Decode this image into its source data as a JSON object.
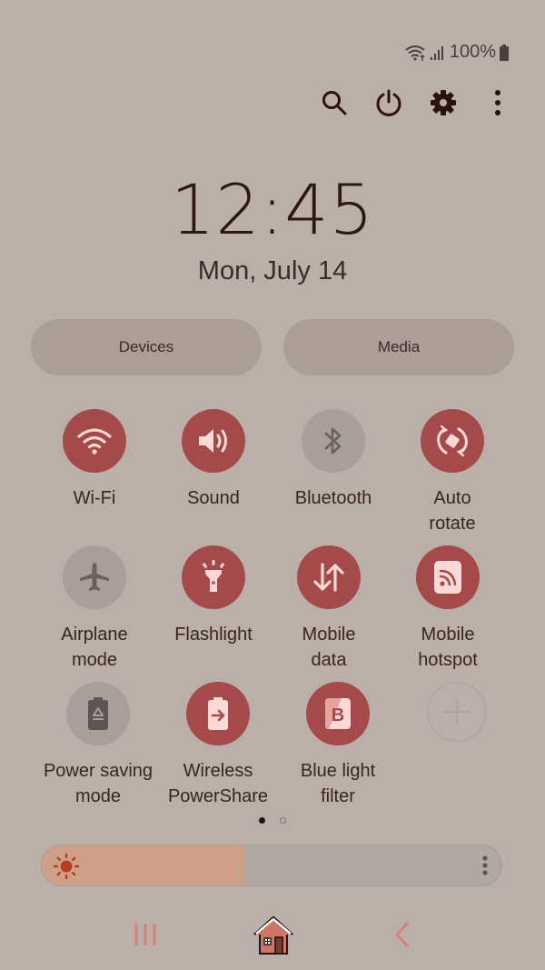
{
  "status_bar": {
    "wifi_icon": "wifi-icon",
    "signal_icon": "signal-icon",
    "battery_percent": "100%",
    "battery_icon": "battery-icon"
  },
  "top_actions": [
    {
      "name": "search",
      "icon": "search-icon"
    },
    {
      "name": "power",
      "icon": "power-icon"
    },
    {
      "name": "settings",
      "icon": "gear-icon"
    },
    {
      "name": "more",
      "icon": "more-vertical-icon"
    }
  ],
  "clock": {
    "time": "12:45",
    "date": "Mon, July 14"
  },
  "pills": {
    "devices": "Devices",
    "media": "Media"
  },
  "tiles": [
    {
      "label": "Wi-Fi",
      "icon": "wifi-icon",
      "state": "on"
    },
    {
      "label": "Sound",
      "icon": "speaker-icon",
      "state": "on"
    },
    {
      "label": "Bluetooth",
      "icon": "bluetooth-icon",
      "state": "off"
    },
    {
      "label": "Auto\nrotate",
      "icon": "auto-rotate-icon",
      "state": "on"
    },
    {
      "label": "Airplane\nmode",
      "icon": "airplane-icon",
      "state": "off"
    },
    {
      "label": "Flashlight",
      "icon": "flashlight-icon",
      "state": "on"
    },
    {
      "label": "Mobile\ndata",
      "icon": "mobile-data-icon",
      "state": "on"
    },
    {
      "label": "Mobile\nhotspot",
      "icon": "hotspot-icon",
      "state": "on"
    },
    {
      "label": "Power saving\nmode",
      "icon": "power-saving-icon",
      "state": "off"
    },
    {
      "label": "Wireless\nPowerShare",
      "icon": "wireless-powershare-icon",
      "state": "on"
    },
    {
      "label": "Blue light\nfilter",
      "icon": "blue-light-filter-icon",
      "state": "on"
    },
    {
      "label": "",
      "icon": "plus-icon",
      "state": "add"
    }
  ],
  "pages": {
    "current": 1,
    "total": 2
  },
  "brightness": {
    "level_percent": 44,
    "icon": "sun-icon",
    "more_icon": "more-vertical-icon"
  },
  "nav_bar": {
    "recents_icon": "recents-icon",
    "home_icon": "home-icon",
    "back_icon": "back-icon"
  },
  "colors": {
    "background": "#bbafa9",
    "tile_on": "#a54a4a",
    "tile_off": "#a89f9a",
    "brightness_fill": "#cfa089",
    "nav_accent": "#d58378"
  }
}
